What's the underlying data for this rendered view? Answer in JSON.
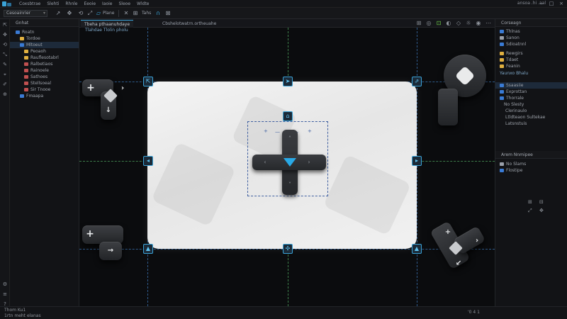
{
  "menubar": {
    "items": [
      "Coxsbtrae",
      "Slehti",
      "Rhnle",
      "Eeoie",
      "Iaoie",
      "Sleoe",
      "Wldte"
    ],
    "right_text": "ansoa .hi .aal"
  },
  "toolbar": {
    "dropdown": "Cesoainrier",
    "label_plane": "Plane",
    "label_tahs": "Tahs",
    "accent": "#3aa3d8"
  },
  "outliner": {
    "title": "Gnhat",
    "rows": [
      {
        "label": "Roatn",
        "icon": "scene-icon",
        "color": "#3a7bd5"
      },
      {
        "label": "Tordoe",
        "icon": "object-icon",
        "color": "#e0b040"
      },
      {
        "label": "Mltoeut",
        "icon": "object-icon",
        "color": "#3a7bd5"
      },
      {
        "label": "Peoaoh",
        "icon": "mesh-icon",
        "color": "#e0b040"
      },
      {
        "label": "Rauflesotabrl",
        "icon": "folder-icon",
        "color": "#e0b040"
      },
      {
        "label": "Ralbetiaos",
        "icon": "mesh-icon",
        "color": "#c05050"
      },
      {
        "label": "Rainoele",
        "icon": "mesh-icon",
        "color": "#c05050"
      },
      {
        "label": "Sathoes",
        "icon": "mesh-icon",
        "color": "#c05050"
      },
      {
        "label": "Stellsoeal",
        "icon": "mesh-icon",
        "color": "#c05050"
      },
      {
        "label": "Sir Tnooe",
        "icon": "mesh-icon",
        "color": "#c05050"
      },
      {
        "label": "Fmaapa",
        "icon": "image-icon",
        "color": "#3a7bd5"
      }
    ]
  },
  "viewport": {
    "tab_active": "Tbeha pthaanuhdaye",
    "tab_second": "Cbshelotwatrn.ortheuahe",
    "subtab": "Tlahdae Tlolin pholu"
  },
  "rightpanel": {
    "top_title": "Corseagn",
    "top_rows": [
      {
        "label": "Thlnas",
        "color": "#3a7bd5"
      },
      {
        "label": "Sanon",
        "color": "#9aa0aa"
      },
      {
        "label": "Sdioatnnl",
        "color": "#3a7bd5"
      },
      {
        "label": "Rewgirs",
        "color": "#e0b040"
      },
      {
        "label": "Tdaet",
        "color": "#e0b040"
      },
      {
        "label": "Feanin",
        "color": "#e0b040"
      }
    ],
    "mid_label": "Yaunxo Bhalu",
    "mid_rows": [
      {
        "label": "Ssaasiie",
        "color": "#3a7bd5"
      },
      {
        "label": "Exprottan",
        "color": "#3a7bd5"
      },
      {
        "label": "Thorrale",
        "color": "#3a7bd5"
      },
      {
        "label": "No Slesty",
        "color": "#9aa0aa"
      },
      {
        "label": "Clerinaulo",
        "color": "#9aa0aa"
      },
      {
        "label": "Ltldteaon Sultekae",
        "color": "#9aa0aa"
      },
      {
        "label": "Latsnstuis",
        "color": "#9aa0aa"
      }
    ],
    "bottom_title": "Arem Nnmipee",
    "bottom_rows": [
      {
        "label": "No Slams",
        "color": "#9aa0aa"
      },
      {
        "label": "Flostipe",
        "color": "#3a7bd5"
      }
    ]
  },
  "statusbar": {
    "left_top": "Thom  Ku1",
    "left_bottom": "1rtn  meht  elanas",
    "right_text": "'0 4 1"
  }
}
